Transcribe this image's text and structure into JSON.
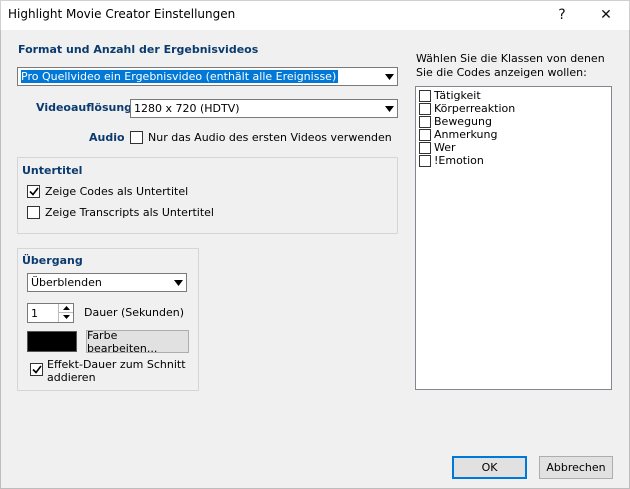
{
  "window": {
    "title": "Highlight Movie Creator Einstellungen",
    "help_glyph": "?",
    "close_glyph": "✕"
  },
  "format": {
    "heading": "Format und Anzahl der Ergebnisvideos",
    "selected": "Pro Quellvideo ein Ergebnisvideo (enthält alle Ereignisse)"
  },
  "resolution": {
    "label": "Videoauflösung",
    "selected": "1280 x 720 (HDTV)"
  },
  "audio": {
    "label": "Audio",
    "checkbox_label": "Nur das Audio des ersten Videos verwenden",
    "checked": false
  },
  "subtitles": {
    "heading": "Untertitel",
    "options": [
      {
        "label": "Zeige Codes als Untertitel",
        "checked": true
      },
      {
        "label": "Zeige Transcripts als Untertitel",
        "checked": false
      }
    ]
  },
  "transition": {
    "heading": "Übergang",
    "selected": "Überblenden",
    "duration_value": "1",
    "duration_label": "Dauer (Sekunden)",
    "color_swatch": "#000000",
    "edit_color_label": "Farbe bearbeiten...",
    "add_duration_label_line1": "Effekt-Dauer zum Schnitt",
    "add_duration_label_line2": "addieren",
    "add_duration_checked": true
  },
  "classes": {
    "instruction": "Wählen Sie die Klassen von denen Sie die Codes anzeigen wollen:",
    "items": [
      {
        "label": "Tätigkeit",
        "checked": false
      },
      {
        "label": "Körperreaktion",
        "checked": false
      },
      {
        "label": "Bewegung",
        "checked": false
      },
      {
        "label": "Anmerkung",
        "checked": false
      },
      {
        "label": "Wer",
        "checked": false
      },
      {
        "label": "!Emotion",
        "checked": false
      }
    ]
  },
  "buttons": {
    "ok_label": "OK",
    "cancel_label": "Abbrechen"
  },
  "colors": {
    "heading_blue": "#0b3b6e",
    "selection_blue": "#0078d7"
  }
}
